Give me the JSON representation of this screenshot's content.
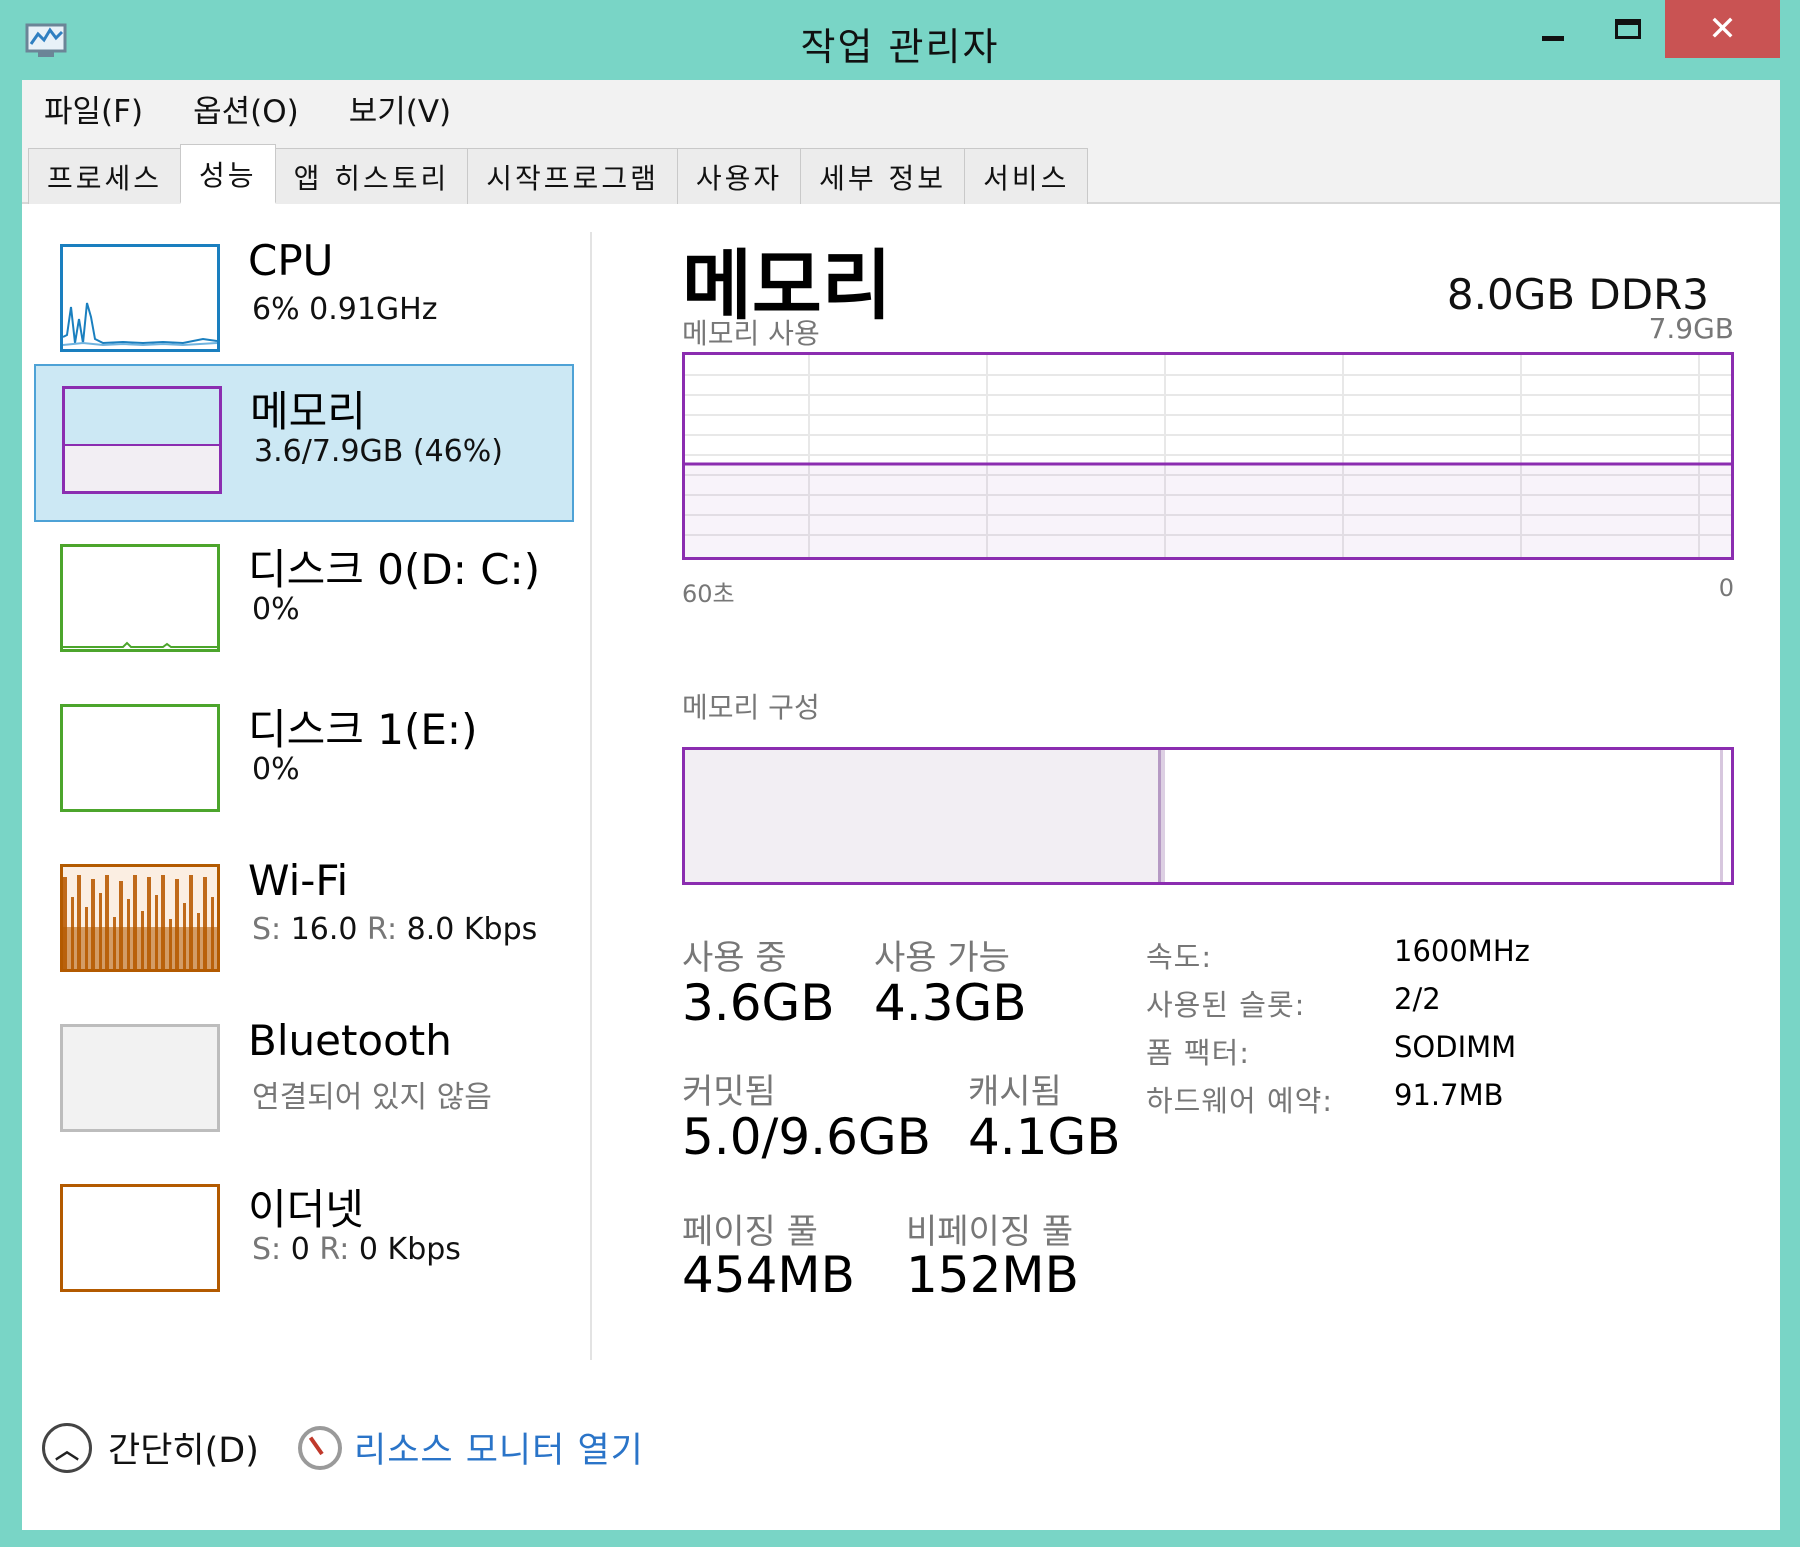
{
  "window": {
    "title": "작업 관리자",
    "close_glyph": "✕",
    "accent_color": "#79d5c6",
    "close_color": "#c95353"
  },
  "menu": {
    "items": [
      "파일(F)",
      "옵션(O)",
      "보기(V)"
    ]
  },
  "tabs": {
    "items": [
      "프로세스",
      "성능",
      "앱 히스토리",
      "시작프로그램",
      "사용자",
      "세부 정보",
      "서비스"
    ],
    "active": "성능"
  },
  "resources": [
    {
      "name": "CPU",
      "sub": "6% 0.91GHz",
      "color": "#1a7fbf",
      "selected": false
    },
    {
      "name": "메모리",
      "sub": "3.6/7.9GB (46%)",
      "color": "#8b2db0",
      "selected": true,
      "fill": 0.46
    },
    {
      "name": "디스크 0(D: C:)",
      "sub": "0%",
      "color": "#4ca52c",
      "selected": false
    },
    {
      "name": "디스크 1(E:)",
      "sub": "0%",
      "color": "#4ca52c",
      "selected": false
    },
    {
      "name": "Wi-Fi",
      "sub_s_label": "S:",
      "sub_s_value": "16.0",
      "sub_r_label": "R:",
      "sub_r_value": "8.0 Kbps",
      "color": "#b35a00",
      "selected": false
    },
    {
      "name": "Bluetooth",
      "sub": "연결되어 있지 않음",
      "color": "#bdbdbd",
      "selected": false
    },
    {
      "name": "이더넷",
      "sub_s_label": "S:",
      "sub_s_value": "0",
      "sub_r_label": "R:",
      "sub_r_value": "0 Kbps",
      "color": "#b35a00",
      "selected": false
    }
  ],
  "detail": {
    "title": "메모리",
    "spec": "8.0GB DDR3",
    "usage_label": "메모리 사용",
    "usage_max": "7.9GB",
    "usage_fraction": 0.46,
    "time_left": "60초",
    "time_right": "0",
    "composition_label": "메모리 구성",
    "composition_used_fraction": 0.46,
    "stats": {
      "in_use_label": "사용 중",
      "in_use_value": "3.6GB",
      "available_label": "사용 가능",
      "available_value": "4.3GB",
      "committed_label": "커밋됨",
      "committed_value": "5.0/9.6GB",
      "cached_label": "캐시됨",
      "cached_value": "4.1GB",
      "paged_label": "페이징 풀",
      "paged_value": "454MB",
      "nonpaged_label": "비페이징 풀",
      "nonpaged_value": "152MB"
    },
    "properties": [
      {
        "key": "속도:",
        "value": "1600MHz"
      },
      {
        "key": "사용된 슬롯:",
        "value": "2/2"
      },
      {
        "key": "폼 팩터:",
        "value": "SODIMM"
      },
      {
        "key": "하드웨어 예약:",
        "value": "91.7MB"
      }
    ]
  },
  "bottom": {
    "collapse_label": "간단히(D)",
    "monitor_link": "리소스 모니터 열기"
  }
}
